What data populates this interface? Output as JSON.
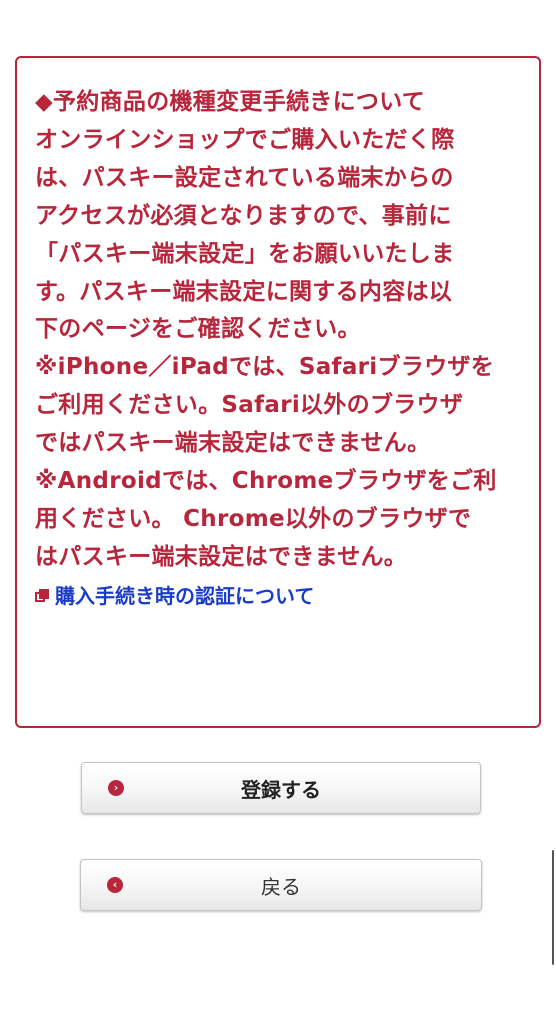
{
  "notice": {
    "lines": [
      "◆予約商品の機種変更手続きについて",
      "オンラインショップでご購入いただく際",
      "は、パスキー設定されている端末からの",
      "アクセスが必須となりますので、事前に",
      "「パスキー端末設定」をお願いいたしま",
      "す。パスキー端末設定に関する内容は以",
      "下のページをご確認ください。",
      "※iPhone／iPadでは、Safariブラウザを",
      "ご利用ください。Safari以外のブラウザ",
      "ではパスキー端末設定はできません。",
      "※Androidでは、Chromeブラウザをご利",
      "用ください。 Chrome以外のブラウザで",
      "はパスキー端末設定はできません。"
    ],
    "link_label": "購入手続き時の認証について"
  },
  "buttons": {
    "register_label": "登録する",
    "register_icon": "chevron-right-icon",
    "back_label": "戻る",
    "back_icon": "chevron-left-icon"
  },
  "colors": {
    "accent": "#b8263c",
    "link": "#1a3cc8"
  }
}
